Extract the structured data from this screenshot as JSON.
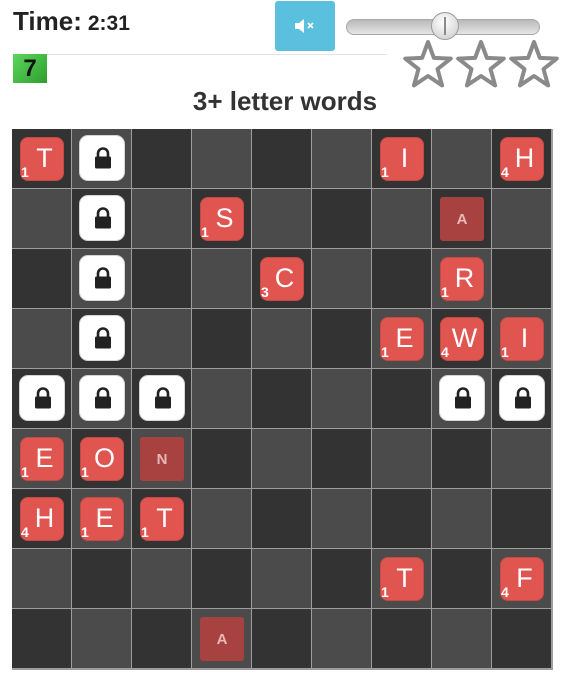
{
  "header": {
    "time_label": "Time:",
    "time_value": "2:31",
    "mute_icon": "speaker-muted-icon",
    "volume_level": 0.5,
    "level": "7",
    "stars_earned": 0,
    "stars_total": 3
  },
  "title": "3+ letter words",
  "colors": {
    "light_cell": "#4b4b4b",
    "dark_cell": "#333333",
    "tile": "#e0554f",
    "ghost": "#a84240",
    "mute_button": "#5bc0de"
  },
  "board": {
    "rows": [
      [
        {
          "t": "tile",
          "letter": "T",
          "points": "1"
        },
        {
          "t": "lock"
        },
        {
          "t": "empty"
        },
        {
          "t": "empty"
        },
        {
          "t": "empty"
        },
        {
          "t": "empty"
        },
        {
          "t": "tile",
          "letter": "I",
          "points": "1"
        },
        {
          "t": "empty"
        },
        {
          "t": "tile",
          "letter": "H",
          "points": "4"
        }
      ],
      [
        {
          "t": "empty"
        },
        {
          "t": "lock"
        },
        {
          "t": "empty"
        },
        {
          "t": "tile",
          "letter": "S",
          "points": "1"
        },
        {
          "t": "empty"
        },
        {
          "t": "empty"
        },
        {
          "t": "empty"
        },
        {
          "t": "ghost",
          "letter": "A"
        },
        {
          "t": "empty"
        }
      ],
      [
        {
          "t": "empty"
        },
        {
          "t": "lock"
        },
        {
          "t": "empty"
        },
        {
          "t": "empty"
        },
        {
          "t": "tile",
          "letter": "C",
          "points": "3"
        },
        {
          "t": "empty"
        },
        {
          "t": "empty"
        },
        {
          "t": "tile",
          "letter": "R",
          "points": "1"
        },
        {
          "t": "empty"
        }
      ],
      [
        {
          "t": "empty"
        },
        {
          "t": "lock"
        },
        {
          "t": "empty"
        },
        {
          "t": "empty"
        },
        {
          "t": "empty"
        },
        {
          "t": "empty"
        },
        {
          "t": "tile",
          "letter": "E",
          "points": "1"
        },
        {
          "t": "tile",
          "letter": "W",
          "points": "4"
        },
        {
          "t": "tile",
          "letter": "I",
          "points": "1"
        }
      ],
      [
        {
          "t": "lock"
        },
        {
          "t": "lock"
        },
        {
          "t": "lock"
        },
        {
          "t": "empty"
        },
        {
          "t": "empty"
        },
        {
          "t": "empty"
        },
        {
          "t": "empty"
        },
        {
          "t": "lock"
        },
        {
          "t": "lock"
        }
      ],
      [
        {
          "t": "tile",
          "letter": "E",
          "points": "1"
        },
        {
          "t": "tile",
          "letter": "O",
          "points": "1"
        },
        {
          "t": "ghost",
          "letter": "N"
        },
        {
          "t": "empty"
        },
        {
          "t": "empty"
        },
        {
          "t": "empty"
        },
        {
          "t": "empty"
        },
        {
          "t": "empty"
        },
        {
          "t": "empty"
        }
      ],
      [
        {
          "t": "tile",
          "letter": "H",
          "points": "4"
        },
        {
          "t": "tile",
          "letter": "E",
          "points": "1"
        },
        {
          "t": "tile",
          "letter": "T",
          "points": "1"
        },
        {
          "t": "empty"
        },
        {
          "t": "empty"
        },
        {
          "t": "empty"
        },
        {
          "t": "empty"
        },
        {
          "t": "empty"
        },
        {
          "t": "empty"
        }
      ],
      [
        {
          "t": "empty"
        },
        {
          "t": "empty"
        },
        {
          "t": "empty"
        },
        {
          "t": "empty"
        },
        {
          "t": "empty"
        },
        {
          "t": "empty"
        },
        {
          "t": "tile",
          "letter": "T",
          "points": "1"
        },
        {
          "t": "empty"
        },
        {
          "t": "tile",
          "letter": "F",
          "points": "4"
        }
      ],
      [
        {
          "t": "empty"
        },
        {
          "t": "empty"
        },
        {
          "t": "empty"
        },
        {
          "t": "ghost",
          "letter": "A"
        },
        {
          "t": "empty"
        },
        {
          "t": "empty"
        },
        {
          "t": "empty"
        },
        {
          "t": "empty"
        },
        {
          "t": "empty"
        }
      ]
    ]
  }
}
